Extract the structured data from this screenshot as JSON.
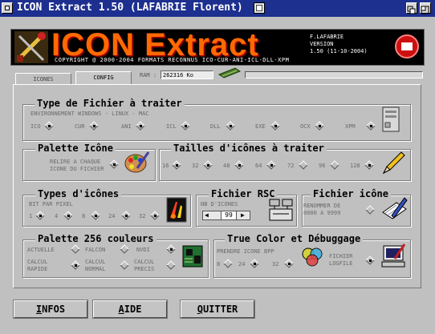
{
  "window": {
    "title": "ICON Extract 1.50 (LAFABRIE Florent)"
  },
  "banner": {
    "title": "ICON Extract",
    "copyright": "COPYRIGHT @ 2000-2004   FORMATS RECONNUS ICO-CUR-ANI-ICL-DLL-XPM",
    "author": "F.LAFABRIE",
    "version_label": "VERSION",
    "version": "1.50 (11-10-2004)"
  },
  "tabs": [
    {
      "label": "ICONES",
      "active": false
    },
    {
      "label": "CONFIG",
      "active": true
    }
  ],
  "ram": {
    "label": "RAM :",
    "value": "262316 Ko"
  },
  "sections": {
    "file_type": {
      "title": "Type de Fichier à traiter",
      "subtitle": "ENVIRONNEMENT WINDOWS - LINUX - MAC",
      "options": [
        "ICO",
        "CUR",
        "ANI",
        "ICL",
        "DLL",
        "EXE",
        "OCX",
        "XPM"
      ]
    },
    "palette_icon": {
      "title": "Palette Icône",
      "text_line1": "RELIRE A CHAQUE",
      "text_line2": "ICONE DU FICHIER"
    },
    "sizes": {
      "title": "Tailles d'icônes à traiter",
      "options": [
        "16",
        "32",
        "48",
        "64",
        "72",
        "96",
        "128"
      ]
    },
    "icon_types": {
      "title": "Types d'icônes",
      "subtitle": "BIT PAR PIXEL",
      "options": [
        "1",
        "4",
        "8",
        "24",
        "32"
      ]
    },
    "rsc_file": {
      "title": "Fichier RSC",
      "subtitle": "NB D'ICONES",
      "value": "99"
    },
    "icon_file": {
      "title": "Fichier icône",
      "text_line1": "RENOMMER DE",
      "text_line2": "0000 A 9999"
    },
    "palette256": {
      "title": "Palette 256 couleurs",
      "row1": [
        "ACTUELLE",
        "FALCON",
        "NVDI"
      ],
      "row2": [
        {
          "l1": "CALCUL",
          "l2": "RAPIDE"
        },
        {
          "l1": "CALCUL",
          "l2": "NORMAL"
        },
        {
          "l1": "CALCUL",
          "l2": "PRECIS"
        }
      ]
    },
    "truecolor": {
      "title": "True Color et Débuggage",
      "bpp_label": "PRENDRE ICONE BPP",
      "bpp_options": [
        "8",
        "24",
        "32"
      ],
      "log_line1": "FICHIER",
      "log_line2": "LOGFILE"
    }
  },
  "buttons": {
    "infos_first": "I",
    "infos_rest": "NFOS",
    "aide_first": "A",
    "aide_rest": "IDE",
    "quitter_first": "Q",
    "quitter_rest": "UITTER"
  }
}
